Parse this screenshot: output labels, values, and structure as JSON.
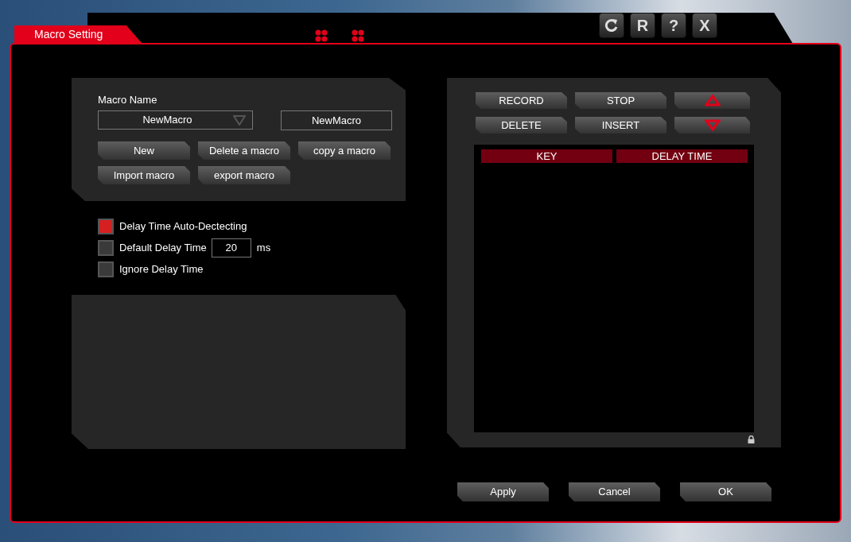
{
  "window": {
    "title": "Macro Setting",
    "controls": [
      {
        "kind": "refresh"
      },
      {
        "kind": "text",
        "label": "R"
      },
      {
        "kind": "text",
        "label": "?"
      },
      {
        "kind": "text",
        "label": "X"
      }
    ]
  },
  "macro": {
    "name_label": "Macro Name",
    "selector_value": "NewMacro",
    "name_field_value": "NewMacro",
    "buttons": [
      "New",
      "Delete a macro",
      "copy a macro",
      "Import macro",
      "export macro"
    ]
  },
  "options": [
    {
      "kind": "checkbox",
      "label": "Delay Time Auto-Dectecting",
      "checked": true
    },
    {
      "kind": "delay",
      "label": "Default Delay Time",
      "checked": false,
      "value": "20",
      "unit": "ms"
    },
    {
      "kind": "checkbox",
      "label": "Ignore Delay Time",
      "checked": false
    }
  ],
  "recorder": {
    "buttons": [
      {
        "kind": "text",
        "label": "RECORD"
      },
      {
        "kind": "text",
        "label": "STOP"
      },
      {
        "kind": "up"
      },
      {
        "kind": "text",
        "label": "DELETE"
      },
      {
        "kind": "text",
        "label": "INSERT"
      },
      {
        "kind": "down"
      }
    ],
    "columns": [
      "KEY",
      "DELAY TIME"
    ]
  },
  "footer_buttons": [
    "Apply",
    "Cancel",
    "OK"
  ]
}
